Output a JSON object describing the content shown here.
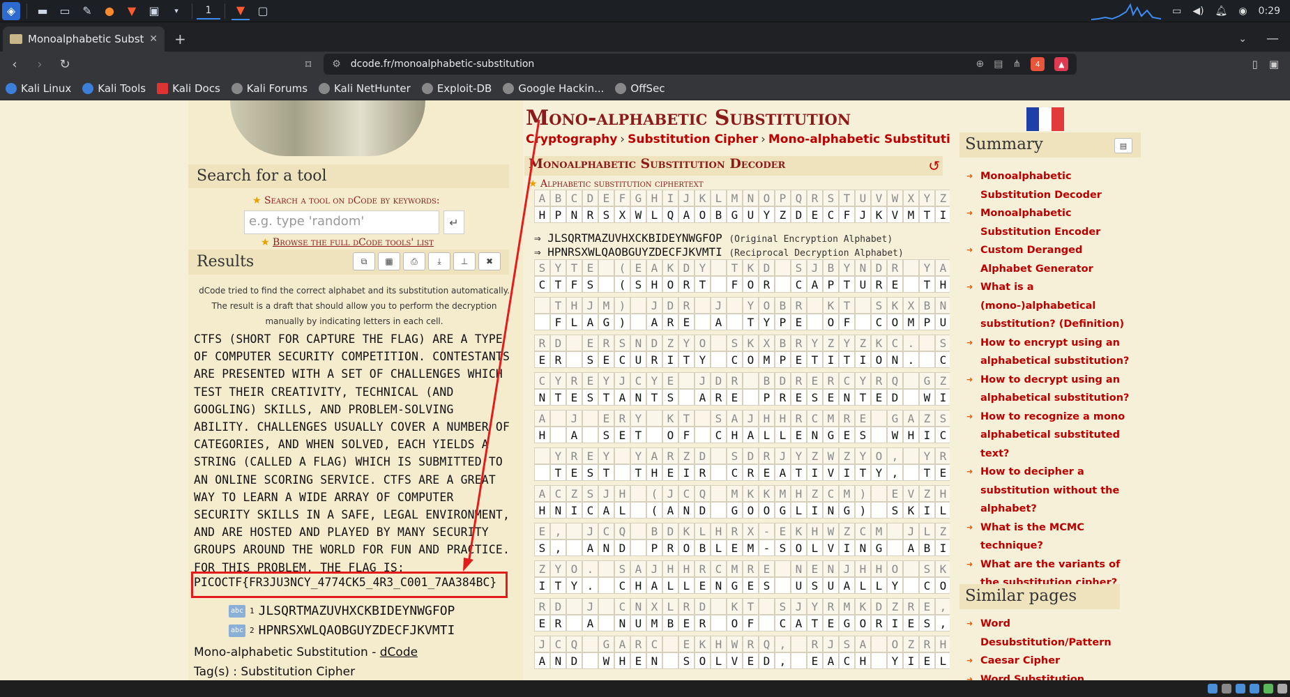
{
  "taskbar": {
    "workspace": "1",
    "clock": "0:29"
  },
  "browser": {
    "tab_title": "Monoalphabetic Substitu",
    "url": "dcode.fr/monoalphabetic-substitution",
    "shield_count": "4",
    "bookmarks": [
      "Kali Linux",
      "Kali Tools",
      "Kali Docs",
      "Kali Forums",
      "Kali NetHunter",
      "Exploit-DB",
      "Google Hackin...",
      "OffSec"
    ]
  },
  "left": {
    "search_title": "Search for a tool",
    "search_label": "Search a tool on dCode by keywords:",
    "search_placeholder": "e.g. type 'random'",
    "browse_label": "Browse the full dCode tools' list",
    "results_title": "Results",
    "note": "dCode tried to find the correct alphabet and its substitution automatically. The result is a draft that should allow you to perform the decryption manually by indicating letters in each cell.",
    "result_text": "CTFS (SHORT FOR CAPTURE THE FLAG) ARE A TYPE\nOF COMPUTER SECURITY COMPETITION. CONTESTANTS\nARE PRESENTED WITH A SET OF CHALLENGES WHICH\nTEST THEIR CREATIVITY, TECHNICAL (AND\nGOOGLING) SKILLS, AND PROBLEM-SOLVING\nABILITY. CHALLENGES USUALLY COVER A NUMBER OF\nCATEGORIES, AND WHEN SOLVED, EACH YIELDS A\nSTRING (CALLED A FLAG) WHICH IS SUBMITTED TO\nAN ONLINE SCORING SERVICE. CTFS ARE A GREAT\nWAY TO LEARN A WIDE ARRAY OF COMPUTER\nSECURITY SKILLS IN A SAFE, LEGAL ENVIRONMENT,\nAND ARE HOSTED AND PLAYED BY MANY SECURITY\nGROUPS AROUND THE WORLD FOR FUN AND PRACTICE.\nFOR THIS PROBLEM, THE FLAG IS:",
    "flag": "PICOCTF{FR3JU3NCY_4774CK5_4R3_C001_7AA384BC}",
    "alpha1_num": "1",
    "alpha1": "JLSQRTMAZUVHXCKBIDEYNWGFOP",
    "alpha2_num": "2",
    "alpha2": "HPNRSXWLQAOBGUYZDECFJKVMTI",
    "footer_title": "Mono-alphabetic Substitution - ",
    "footer_link": "dCode",
    "tags": "Tag(s) : Substitution Cipher"
  },
  "main": {
    "title": "Mono-alphabetic Substitution",
    "crumb1": "Cryptography",
    "crumb2": "Substitution Cipher",
    "crumb3": "Mono-alphabetic Substitution",
    "decoder_title": "Monoalphabetic Substitution Decoder",
    "ciphertext_label": "Alphabetic substitution ciphertext",
    "plain_alpha": "ABCDEFGHIJKLMNOPQRSTUVWXYZ",
    "key_alpha": "HPNRSXWLQAOBGUYZDECFJKVMTI",
    "map1": "JLSQRTMAZUVHXCKBIDEYNWGFOP",
    "map1_note": "(Original Encryption Alphabet)",
    "map2": "HPNRSXWLQAOBGUYZDECFJKVMTI",
    "map2_note": "(Reciprocal Decryption Alphabet)",
    "rows": [
      {
        "c": "SYTE (EAKDY TKD SJBYNDR YAR",
        "p": "CTFS (SHORT FOR CAPTURE THE"
      },
      {
        "c": " THJM) JDR J YOBR KT SKXBNY",
        "p": " FLAG) ARE A TYPE OF COMPUT"
      },
      {
        "c": "RD ERSNDZYO SKXBRYZYZKC. SK",
        "p": "ER SECURITY COMPETITION. CO"
      },
      {
        "c": "CYREYJCYE JDR BDRERCYRQ GZY",
        "p": "NTESTANTS ARE PRESENTED WIT"
      },
      {
        "c": "A J ERY KT SAJHHRCMRE GAZSA",
        "p": "H A SET OF CHALLENGES WHICH"
      },
      {
        "c": " YREY YARZD SDRJYZWZYO, YRS",
        "p": " TEST THEIR CREATIVITY, TEC"
      },
      {
        "c": "ACZSJH (JCQ MKKMHZCM) EVZHH",
        "p": "HNICAL (AND GOOGLING) SKILL"
      },
      {
        "c": "E, JCQ BDKLHRX-EKHWZCM JLZH",
        "p": "S, AND PROBLEM-SOLVING ABIL"
      },
      {
        "c": "ZYO. SAJHHRCMRE NENJHHO SKW",
        "p": "ITY. CHALLENGES USUALLY COV"
      },
      {
        "c": "RD J CNXLRD KT SJYRMKDZRE, ",
        "p": "ER A NUMBER OF CATEGORIES, "
      },
      {
        "c": "JCQ GARC EKHWRQ, RJSA OZRHQ",
        "p": "AND WHEN SOLVED, EACH YIELD"
      }
    ]
  },
  "right": {
    "summary_title": "Summary",
    "summary_items": [
      "Monoalphabetic Substitution Decoder",
      "Monoalphabetic Substitution Encoder",
      "Custom Deranged Alphabet Generator",
      "What is a (mono-)alphabetical substitution? (Definition)",
      "How to encrypt using an alphabetical substitution?",
      "How to decrypt using an alphabetical substitution?",
      "How to recognize a mono alphabetical substituted text?",
      "How to decipher a substitution without the alphabet?",
      "What is the MCMC technique?",
      "What are the variants of the substitution cipher?"
    ],
    "similar_title": "Similar pages",
    "similar_items": [
      "Word Desubstitution/Pattern",
      "Caesar Cipher",
      "Word Substitution"
    ]
  },
  "colors": {
    "dcode_red": "#8b1a1a",
    "link_red": "#bb0000",
    "annotation_red": "#e31b1b"
  }
}
